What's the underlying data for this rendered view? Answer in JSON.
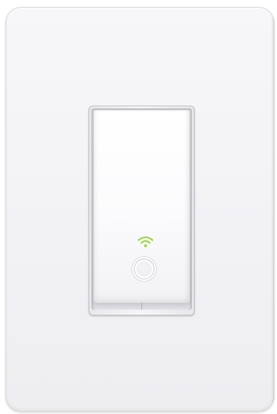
{
  "scene": {
    "subject": "smart-wifi-light-switch",
    "colors": {
      "plate": "#f3f3f6",
      "rocker": "#fbfbfd",
      "wifi_indicator": "#9bd73a",
      "ring": "#ffffff"
    },
    "icons": {
      "status": "wifi-icon",
      "control": "power-button"
    }
  }
}
